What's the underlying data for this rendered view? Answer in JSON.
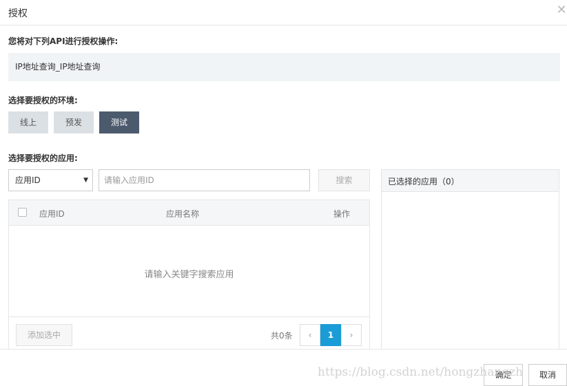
{
  "dialog": {
    "title": "授权",
    "close_icon": "close-icon"
  },
  "api_section": {
    "label": "您将对下列API进行授权操作:",
    "api_name": "IP地址查询_IP地址查询"
  },
  "env_section": {
    "label": "选择要授权的环境:",
    "buttons": [
      {
        "label": "线上",
        "active": false
      },
      {
        "label": "预发",
        "active": false
      },
      {
        "label": "测试",
        "active": true
      }
    ]
  },
  "app_section": {
    "label": "选择要授权的应用:",
    "select_value": "应用ID",
    "search_placeholder": "请输入应用ID",
    "search_button": "搜索",
    "table": {
      "columns": [
        "应用ID",
        "应用名称",
        "操作"
      ],
      "empty_text": "请输入关键字搜索应用",
      "add_selected_button": "添加选中",
      "total_text": "共0条",
      "pagination": {
        "prev": "‹",
        "current": "1",
        "next": "›"
      }
    },
    "selected_panel": {
      "title": "已选择的应用（0）"
    }
  },
  "footer": {
    "ok_button": "确定",
    "cancel_button": "取消"
  },
  "watermark": "https://blog.csdn.net/hongzhangzh",
  "colors": {
    "active_env": "#4c5a6e",
    "page_current": "#1a9cd6",
    "api_box_bg": "#f1f4f6"
  }
}
